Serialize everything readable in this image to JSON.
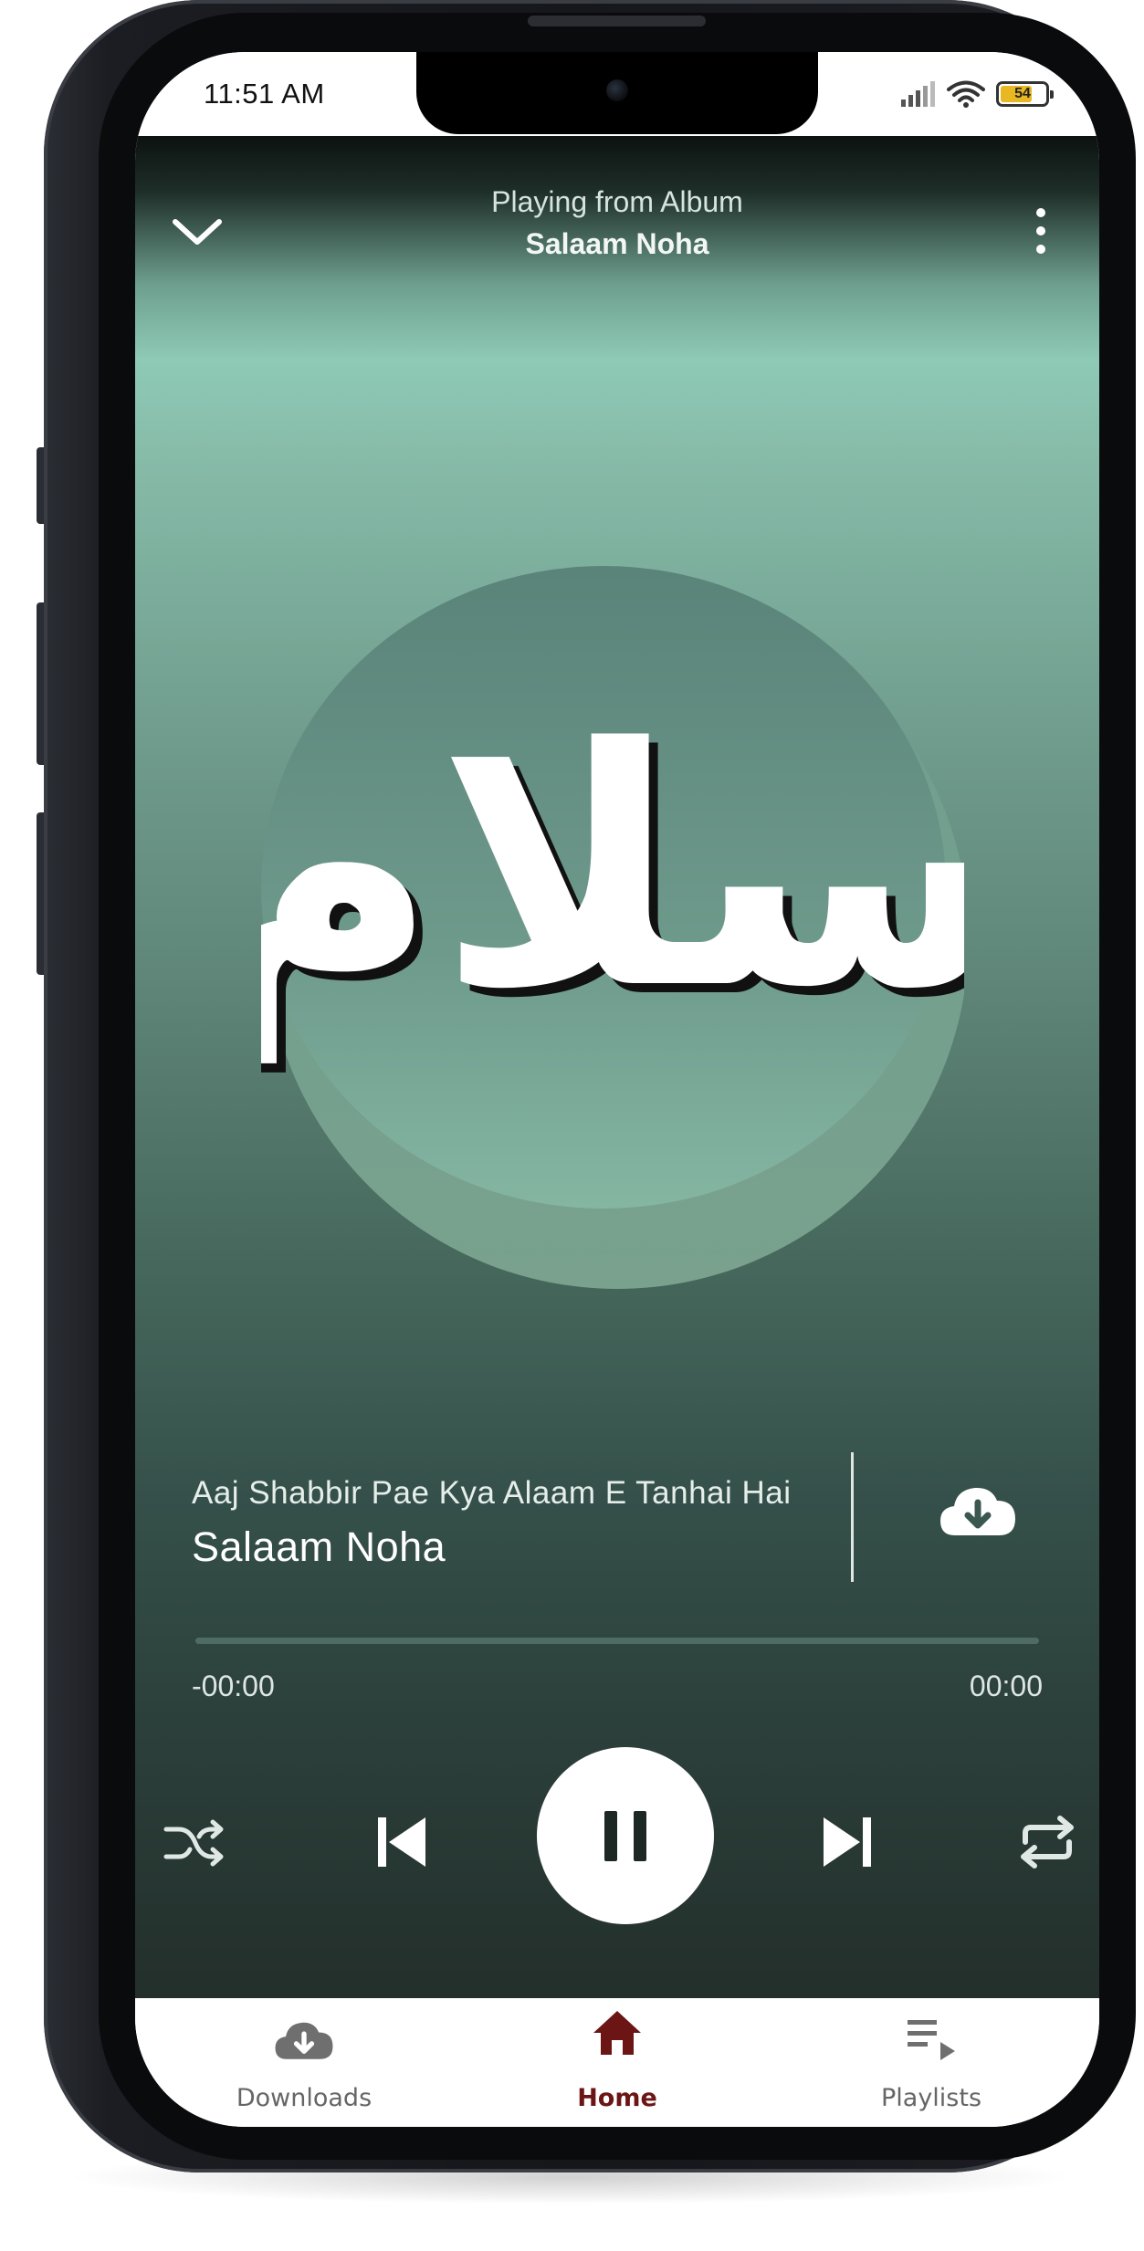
{
  "status_bar": {
    "time": "11:51 AM",
    "battery_level": "54",
    "battery_color": "#e8b721"
  },
  "header": {
    "subtitle": "Playing from Album",
    "title": "Salaam Noha"
  },
  "artwork": {
    "calligraphy_text": "سلام"
  },
  "track": {
    "subtitle": "Aaj Shabbir Pae Kya Alaam E Tanhai Hai",
    "title": "Salaam Noha"
  },
  "progress": {
    "elapsed": "-00:00",
    "duration": "00:00",
    "fraction": 0
  },
  "controls": {
    "shuffle": "shuffle-icon",
    "previous": "skip-previous-icon",
    "play_state": "pause-icon",
    "next": "skip-next-icon",
    "repeat": "repeat-icon"
  },
  "nav": {
    "items": [
      {
        "label": "Downloads",
        "icon": "cloud-download-icon",
        "active": false
      },
      {
        "label": "Home",
        "icon": "home-icon",
        "active": true
      },
      {
        "label": "Playlists",
        "icon": "playlist-icon",
        "active": false
      }
    ],
    "active_color": "#6b1515",
    "inactive_color": "#666666"
  }
}
